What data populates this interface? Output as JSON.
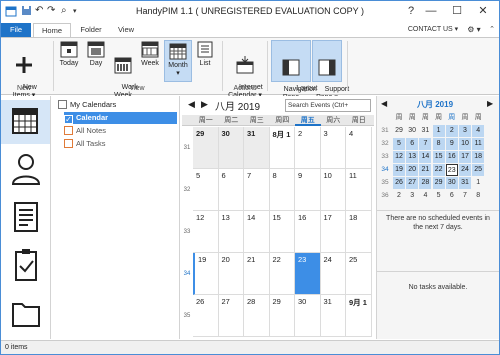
{
  "titlebar": {
    "title": "HandyPIM 1.1 ( UNREGISTERED EVALUATION COPY )",
    "help": "?",
    "minimize": "—",
    "maximize": "☐",
    "close": "✕"
  },
  "tabs": {
    "file": "File",
    "home": "Home",
    "folder": "Folder",
    "view": "View"
  },
  "contact": {
    "label": "CONTACT US ▾",
    "gear": "⚙ ▾"
  },
  "ribbon": {
    "new_items": "New\nItems ▾",
    "today": "Today",
    "day": "Day",
    "work_week": "Work\nWeek",
    "week": "Week",
    "month": "Month",
    "list": "List",
    "internet_calendar": "Internet\nCalendar ▾",
    "navigation_pane": "Navigation\nPane",
    "support_pane": "Support\nPane ▾",
    "group_new": "New",
    "group_view": "View",
    "group_actions": "Actions",
    "group_layout": "Layout"
  },
  "tree": {
    "root": "My Calendars",
    "items": [
      "Calendar",
      "All Notes",
      "All Tasks"
    ]
  },
  "calendar": {
    "month_title": "八月 2019",
    "search_placeholder": "Search Events (Ctrl+",
    "weekdays": [
      "周一",
      "周二",
      "周三",
      "周四",
      "周五",
      "周六",
      "周日"
    ],
    "weeks": [
      {
        "no": "31",
        "days": [
          "29",
          "30",
          "31",
          "8月 1",
          "2",
          "3",
          "4"
        ]
      },
      {
        "no": "32",
        "days": [
          "5",
          "6",
          "7",
          "8",
          "9",
          "10",
          "11"
        ]
      },
      {
        "no": "33",
        "days": [
          "12",
          "13",
          "14",
          "15",
          "16",
          "17",
          "18"
        ]
      },
      {
        "no": "34",
        "days": [
          "19",
          "20",
          "21",
          "22",
          "23",
          "24",
          "25"
        ]
      },
      {
        "no": "35",
        "days": [
          "26",
          "27",
          "28",
          "29",
          "30",
          "31",
          "9月 1"
        ]
      }
    ]
  },
  "mini": {
    "title": "八月 2019",
    "weekdays": [
      "周",
      "周",
      "周",
      "周",
      "周",
      "周",
      "周"
    ],
    "weeks": [
      {
        "no": "31",
        "days": [
          "29",
          "30",
          "31",
          "1",
          "2",
          "3",
          "4"
        ]
      },
      {
        "no": "32",
        "days": [
          "5",
          "6",
          "7",
          "8",
          "9",
          "10",
          "11"
        ]
      },
      {
        "no": "33",
        "days": [
          "12",
          "13",
          "14",
          "15",
          "16",
          "17",
          "18"
        ]
      },
      {
        "no": "34",
        "days": [
          "19",
          "20",
          "21",
          "22",
          "23",
          "24",
          "25"
        ]
      },
      {
        "no": "35",
        "days": [
          "26",
          "27",
          "28",
          "29",
          "30",
          "31",
          "1"
        ]
      },
      {
        "no": "36",
        "days": [
          "2",
          "3",
          "4",
          "5",
          "6",
          "7",
          "8"
        ]
      }
    ],
    "no_events": "There are no scheduled events in the next 7 days.",
    "no_tasks": "No tasks available."
  },
  "status": {
    "items": "0 items"
  },
  "colors": {
    "accent": "#1e73c8",
    "selected": "#3d8ee6",
    "light": "#c5dcf4"
  }
}
